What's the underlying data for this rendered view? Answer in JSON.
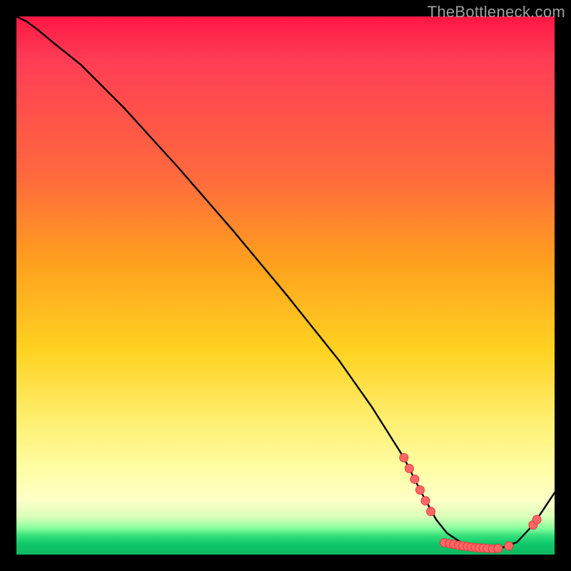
{
  "watermark": "TheBottleneck.com",
  "colors": {
    "border": "#000000",
    "curve": "#000000",
    "marker_fill": "#ff6666",
    "marker_stroke": "#e03a3a",
    "gradient_top": "#ff1744",
    "gradient_bottom": "#0db862"
  },
  "chart_data": {
    "type": "line",
    "title": "",
    "xlabel": "",
    "ylabel": "",
    "xlim": [
      0,
      100
    ],
    "ylim": [
      0,
      100
    ],
    "grid": false,
    "curve": {
      "x": [
        0,
        2,
        4,
        7,
        12,
        20,
        30,
        40,
        50,
        60,
        66,
        72,
        75,
        78,
        80,
        83,
        85,
        88,
        90,
        93,
        96,
        100
      ],
      "y": [
        100,
        99,
        97.5,
        95,
        91,
        83,
        72,
        60.5,
        48.5,
        36,
        27.5,
        18,
        12,
        6.5,
        4,
        2,
        1.3,
        1,
        1.2,
        2.3,
        5.5,
        11.5
      ]
    },
    "markers": [
      {
        "x": 72.0,
        "y": 18.0
      },
      {
        "x": 73.0,
        "y": 16.0
      },
      {
        "x": 74.0,
        "y": 14.0
      },
      {
        "x": 75.0,
        "y": 12.0
      },
      {
        "x": 76.0,
        "y": 10.0
      },
      {
        "x": 77.0,
        "y": 8.0
      },
      {
        "x": 79.5,
        "y": 2.2
      },
      {
        "x": 80.5,
        "y": 2.0
      },
      {
        "x": 81.3,
        "y": 1.9
      },
      {
        "x": 82.2,
        "y": 1.7
      },
      {
        "x": 83.0,
        "y": 1.6
      },
      {
        "x": 83.8,
        "y": 1.5
      },
      {
        "x": 84.5,
        "y": 1.4
      },
      {
        "x": 85.3,
        "y": 1.3
      },
      {
        "x": 86.0,
        "y": 1.25
      },
      {
        "x": 86.8,
        "y": 1.2
      },
      {
        "x": 87.5,
        "y": 1.15
      },
      {
        "x": 88.5,
        "y": 1.1
      },
      {
        "x": 89.5,
        "y": 1.15
      },
      {
        "x": 91.5,
        "y": 1.6
      },
      {
        "x": 96.0,
        "y": 5.5
      },
      {
        "x": 96.7,
        "y": 6.5
      }
    ]
  }
}
